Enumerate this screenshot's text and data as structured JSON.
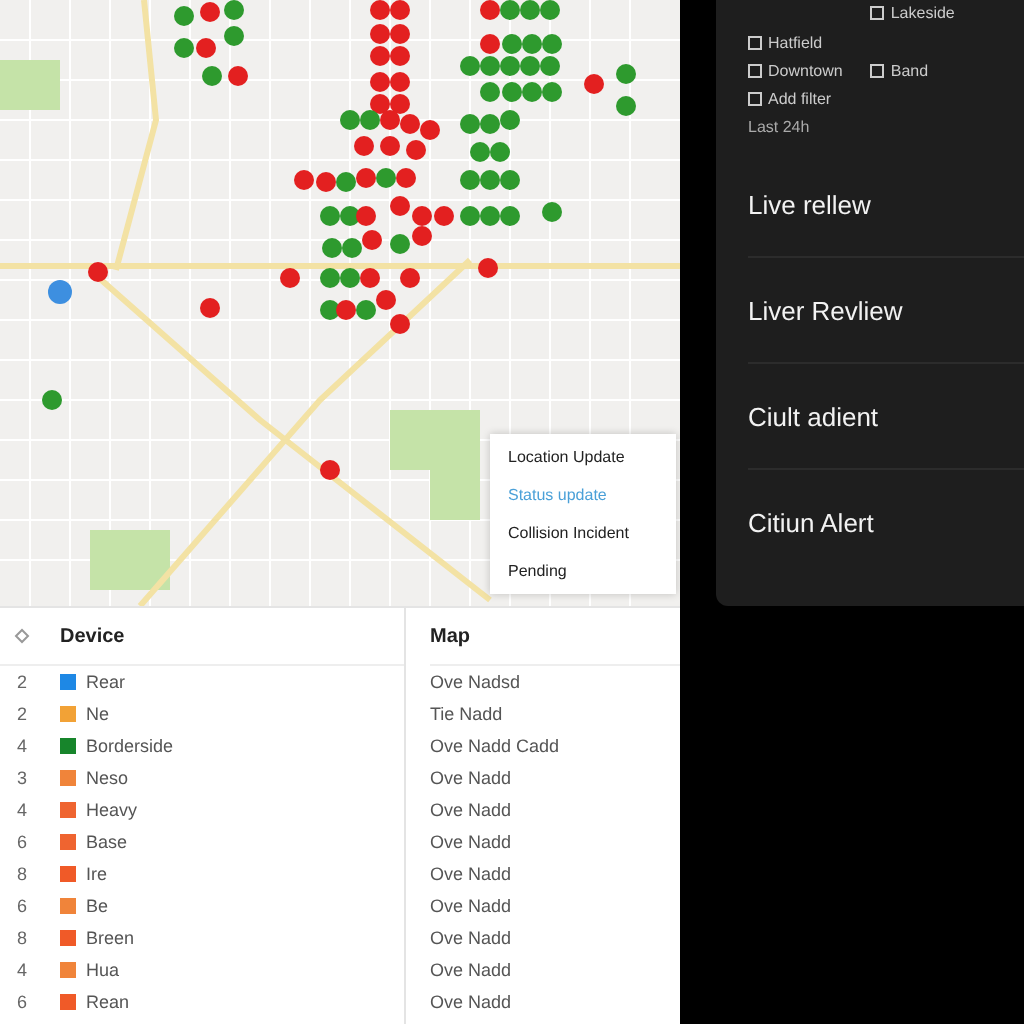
{
  "map_popup": {
    "items": [
      {
        "label": "Location Update",
        "kind": "title"
      },
      {
        "label": "Status update",
        "kind": "link"
      },
      {
        "label": "Collision Incident",
        "kind": "title"
      },
      {
        "label": "Pending",
        "kind": "title"
      }
    ]
  },
  "table": {
    "columns": [
      "Device",
      "Map"
    ],
    "rows": [
      {
        "number": "2",
        "color": "#1e88e5",
        "name": "Rear",
        "map": "Ove Nadsd"
      },
      {
        "number": "2",
        "color": "#f2a236",
        "name": "Ne",
        "map": "Tie Nadd"
      },
      {
        "number": "4",
        "color": "#17852b",
        "name": "Borderside",
        "map": "Ove Nadd Cadd"
      },
      {
        "number": "3",
        "color": "#f0843a",
        "name": "Neso",
        "map": "Ove Nadd"
      },
      {
        "number": "4",
        "color": "#ef6430",
        "name": "Heavy",
        "map": "Ove Nadd"
      },
      {
        "number": "6",
        "color": "#ef6430",
        "name": "Base",
        "map": "Ove Nadd"
      },
      {
        "number": "8",
        "color": "#f05a28",
        "name": "Ire",
        "map": "Ove Nadd"
      },
      {
        "number": "6",
        "color": "#f0843a",
        "name": "Be",
        "map": "Ove Nadd"
      },
      {
        "number": "8",
        "color": "#f05a28",
        "name": "Breen",
        "map": "Ove Nadd"
      },
      {
        "number": "4",
        "color": "#f0843a",
        "name": "Hua",
        "map": "Ove Nadd"
      },
      {
        "number": "6",
        "color": "#f05a28",
        "name": "Rean",
        "map": "Ove Nadd"
      }
    ]
  },
  "side_panel": {
    "left_links": [
      "Hatfield",
      "Downtown",
      "Add filter"
    ],
    "right_links": [
      "Lakeside",
      "Band"
    ],
    "note": "Last 24h",
    "items": [
      {
        "label": "Live rellew"
      },
      {
        "label": "Liver Revliew"
      },
      {
        "label": "Ciult adient"
      },
      {
        "label": "Citiun Alert"
      }
    ]
  }
}
